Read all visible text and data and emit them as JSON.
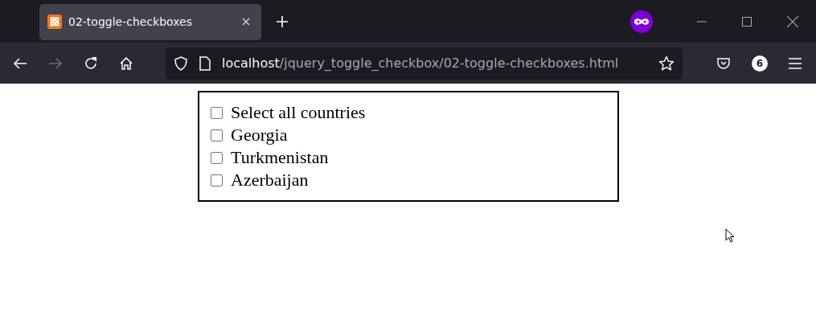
{
  "tabs": [
    {
      "title": "02-toggle-checkboxes",
      "selected": true
    }
  ],
  "toolbar": {
    "forward_disabled": true,
    "url": {
      "host": "localhost",
      "path": "/jquery_toggle_checkbox/02-toggle-checkboxes.html"
    },
    "extensions_badge": "6"
  },
  "page": {
    "checkboxes": [
      {
        "label": "Select all countries",
        "checked": false
      },
      {
        "label": "Georgia",
        "checked": false
      },
      {
        "label": "Turkmenistan",
        "checked": false
      },
      {
        "label": "Azerbaijan",
        "checked": false
      }
    ]
  }
}
